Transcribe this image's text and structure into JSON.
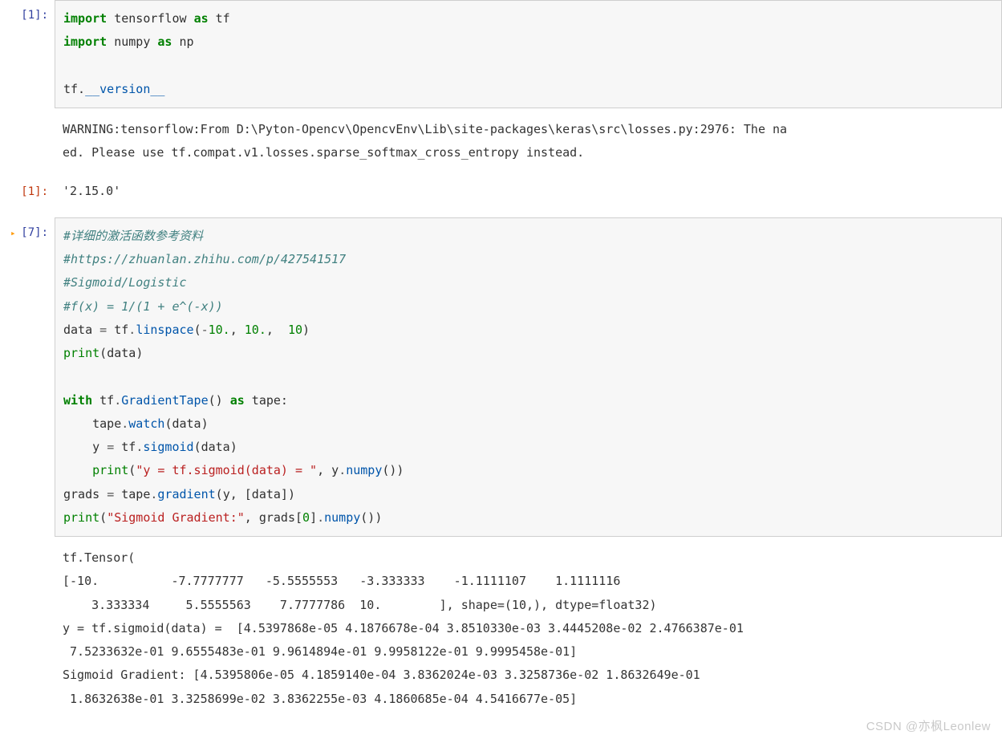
{
  "cells": {
    "c1": {
      "prompt": "[1]:",
      "code": {
        "l1": {
          "kw": "import",
          "mod": "tensorflow",
          "as": "as",
          "alias": "tf"
        },
        "l2": {
          "kw": "import",
          "mod": "numpy",
          "as": "as",
          "alias": "np"
        },
        "l3_prefix": "tf.",
        "l3_attr": "__version__"
      }
    },
    "out1_warn": {
      "line1": "WARNING:tensorflow:From D:\\Pyton-Opencv\\OpencvEnv\\Lib\\site-packages\\keras\\src\\losses.py:2976: The na",
      "line2": "ed. Please use tf.compat.v1.losses.sparse_softmax_cross_entropy instead."
    },
    "out1": {
      "prompt": "[1]:",
      "value": "'2.15.0'"
    },
    "c7": {
      "prompt": "[7]:",
      "comment1": "#详细的激活函数参考资料",
      "comment2": "#https://zhuanlan.zhihu.com/p/427541517",
      "comment3": "#Sigmoid/Logistic",
      "comment4": "#f(x) = 1/(1 + e^(-x))",
      "l5_a": "data ",
      "l5_eq": "=",
      "l5_b": " tf",
      "l5_dot": ".",
      "l5_func": "linspace",
      "l5_open": "(",
      "l5_arg1p": "-",
      "l5_arg1": "10.",
      "l5_c1": ", ",
      "l5_arg2": "10.",
      "l5_c2": ",  ",
      "l5_arg3": "10",
      "l5_close": ")",
      "l6_print": "print",
      "l6_open": "(",
      "l6_arg": "data",
      "l6_close": ")",
      "l8_with": "with",
      "l8_tf": " tf",
      "l8_d": ".",
      "l8_gt": "GradientTape",
      "l8_p": "() ",
      "l8_as": "as",
      "l8_tape": " tape:",
      "l9_pre": "    tape",
      "l9_d": ".",
      "l9_watch": "watch",
      "l9_open": "(",
      "l9_arg": "data",
      "l9_close": ")",
      "l10_pre": "    y ",
      "l10_eq": "=",
      "l10_tf": " tf",
      "l10_d": ".",
      "l10_sig": "sigmoid",
      "l10_open": "(",
      "l10_arg": "data",
      "l10_close": ")",
      "l11_pre": "    ",
      "l11_print": "print",
      "l11_open": "(",
      "l11_str": "\"y = tf.sigmoid(data) = \"",
      "l11_c": ", y",
      "l11_d": ".",
      "l11_np": "numpy",
      "l11_close": "())",
      "l12_a": "grads ",
      "l12_eq": "=",
      "l12_tape": " tape",
      "l12_d": ".",
      "l12_grad": "gradient",
      "l12_open": "(",
      "l12_args": "y, [data]",
      "l12_close": ")",
      "l13_print": "print",
      "l13_open": "(",
      "l13_str": "\"Sigmoid Gradient:\"",
      "l13_c": ", grads[",
      "l13_idx": "0",
      "l13_c2": "]",
      "l13_d": ".",
      "l13_np": "numpy",
      "l13_close": "())"
    },
    "out7": {
      "l1": "tf.Tensor(",
      "l2": "[-10.          -7.7777777   -5.5555553   -3.333333    -1.1111107    1.1111116",
      "l3": "    3.333334     5.5555563    7.7777786  10.        ], shape=(10,), dtype=float32)",
      "l4": "y = tf.sigmoid(data) =  [4.5397868e-05 4.1876678e-04 3.8510330e-03 3.4445208e-02 2.4766387e-01",
      "l5": " 7.5233632e-01 9.6555483e-01 9.9614894e-01 9.9958122e-01 9.9995458e-01]",
      "l6": "Sigmoid Gradient: [4.5395806e-05 4.1859140e-04 3.8362024e-03 3.3258736e-02 1.8632649e-01",
      "l7": " 1.8632638e-01 3.3258699e-02 3.8362255e-03 4.1860685e-04 4.5416677e-05]"
    }
  },
  "watermark": "CSDN @亦枫Leonlew"
}
